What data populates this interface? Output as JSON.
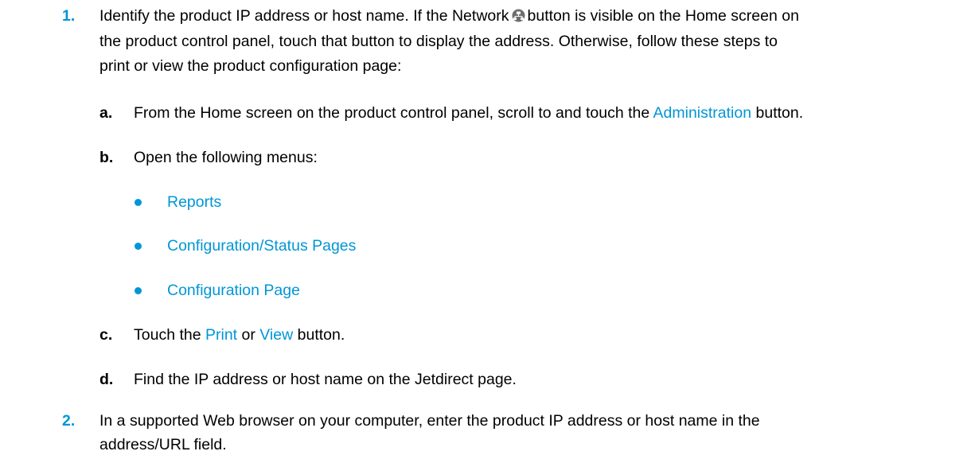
{
  "steps": [
    {
      "number": "1.",
      "text_before_icon": "Identify the product IP address or host name. If the Network",
      "text_after_icon": "button is visible on the Home screen on",
      "line2": "the product control panel, touch that button to display the address. Otherwise, follow these steps to",
      "line3": "print or view the product configuration page:",
      "icon": "network-icon",
      "substeps": [
        {
          "letter": "a.",
          "text_before": "From the Home screen on the product control panel, scroll to and touch the",
          "link": "Administration",
          "text_after": "button."
        },
        {
          "letter": "b.",
          "text": "Open the following menus:",
          "bullets": [
            "Reports",
            "Configuration/Status Pages",
            "Configuration Page"
          ]
        },
        {
          "letter": "c.",
          "text_before": "Touch the",
          "link1": "Print",
          "text_mid": "or",
          "link2": "View",
          "text_after": "button."
        },
        {
          "letter": "d.",
          "text": "Find the IP address or host name on the Jetdirect page."
        }
      ]
    },
    {
      "number": "2.",
      "line1": "In a supported Web browser on your computer, enter the product IP address or host name in the",
      "line2": "address/URL field."
    }
  ],
  "colors": {
    "accent": "#0096d6",
    "text": "#000000",
    "background": "#ffffff"
  }
}
